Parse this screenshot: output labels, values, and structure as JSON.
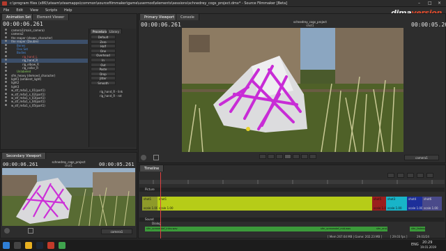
{
  "window": {
    "title": "c:\\program files (x86)\\steam\\steamapps\\common\\sourcefilmmaker\\game\\usermod\\elements\\sessions\\schnedrey_cogs_project.dmx* - Source Filmmaker [Beta]",
    "controls": [
      "–",
      "□",
      "×"
    ]
  },
  "menu": [
    "File",
    "Edit",
    "View",
    "Scripts",
    "Help"
  ],
  "logo": {
    "part1": "dima",
    "part2": "version"
  },
  "left_tabs": [
    "Animation Set Editor",
    "Element Viewer"
  ],
  "left_timecode": "00:00:06.261",
  "tree_rows": [
    {
      "label": "camera1(main_camera)",
      "style": "normal",
      "indent": 0
    },
    {
      "label": "camera2",
      "style": "normal",
      "indent": 0
    },
    {
      "label": "the reaper (shown_character)",
      "style": "normal",
      "indent": 0
    },
    {
      "label": "the reaper (Double)",
      "style": "sel",
      "indent": 0
    },
    {
      "label": "Bones",
      "style": "blue",
      "indent": 4
    },
    {
      "label": "Flex Set",
      "style": "blue",
      "indent": 4
    },
    {
      "label": "Bodies",
      "style": "blue",
      "indent": 4
    },
    {
      "label": "rig_hand_L",
      "style": "red",
      "indent": 8
    },
    {
      "label": "rig_hand_R",
      "style": "sel",
      "indent": 8
    },
    {
      "label": "rig_elbow_R",
      "style": "normal",
      "indent": 8
    },
    {
      "label": "rig_collar_R",
      "style": "normal",
      "indent": 8
    },
    {
      "label": "Unlabeled",
      "style": "green",
      "indent": 4
    },
    {
      "label": "sfm_heavy (demoed_character)",
      "style": "normal",
      "indent": 0
    },
    {
      "label": "light1 (ambient_light)",
      "style": "normal",
      "indent": 0
    },
    {
      "label": "light2",
      "style": "normal",
      "indent": 0
    },
    {
      "label": "light3",
      "style": "normal",
      "indent": 0
    },
    {
      "label": "w_stf_m4a1_s_01(part1)",
      "style": "normal",
      "indent": 0
    },
    {
      "label": "w_stf_m4a1_s_02(part1)",
      "style": "normal",
      "indent": 0
    },
    {
      "label": "w_stf_m4a1_s_03(part1)",
      "style": "normal",
      "indent": 0
    },
    {
      "label": "w_stf_m4a1_s_04(part1)",
      "style": "normal",
      "indent": 0
    },
    {
      "label": "w_stf_m4a1_s_05(part1)",
      "style": "normal",
      "indent": 0
    }
  ],
  "presets": {
    "tabs": [
      "Procedural",
      "Library"
    ],
    "buttons": [
      "Default",
      "Zero",
      "Half",
      "One",
      "Overhead",
      "In",
      "Out",
      "Paste",
      "Drop",
      "Jitter",
      "Smooth"
    ],
    "bones": [
      "rig_hand_R - link",
      "rig_hand_R - rot"
    ]
  },
  "secondary_viewport": {
    "tab": "Secondary Viewport",
    "timecode_left": "00:00:06.261",
    "timecode_right": "00:00:05.261",
    "shot_name": "schnedrey_cogs_project",
    "shot_sub": "shot1",
    "camera": "camera1"
  },
  "primary_viewport": {
    "tabs": [
      "Primary Viewport",
      "Console"
    ],
    "timecode_left": "00:00:06.261",
    "timecode_right": "00:00:05.261",
    "shot_name": "schnedrey_cogs_project",
    "shot_sub": "shot1",
    "camera": "camera1"
  },
  "timeline": {
    "tab": "Timeline",
    "sections": [
      "Picture",
      "Sound"
    ],
    "sound_track": "Dialog",
    "clips": [
      {
        "label": "shot1",
        "sub": "scale 1.00",
        "color": "#8e9a2a"
      },
      {
        "label": "shot1",
        "sub": "scale 1.00",
        "color": "#b6cc18"
      },
      {
        "label": "shot5",
        "sub": "scale 1.00",
        "color": "#9a1e1e"
      },
      {
        "label": "shot3",
        "sub": "scale 1.00",
        "color": "#18b4c8"
      },
      {
        "label": "shot4",
        "sub": "scale 1.00",
        "color": "#1d2f9a"
      },
      {
        "label": "shot6",
        "sub": "scale 1.00",
        "color": "#4a4a8a"
      }
    ],
    "sound_clips": [
      "sfm_screamdef_intro.wav",
      "sfm_screamdef_mid.wav",
      "sfm_end.wav",
      "sfm_fadeout.wav"
    ]
  },
  "status": {
    "mem": "[ Mem 267.64 MB | Game: 202.23 MB ]",
    "fps": "[ 29.03 fps ]",
    "frames": "29.03/24"
  },
  "taskbar": {
    "lang": "ENG",
    "time": "20:29",
    "date": "19.01.2019"
  }
}
